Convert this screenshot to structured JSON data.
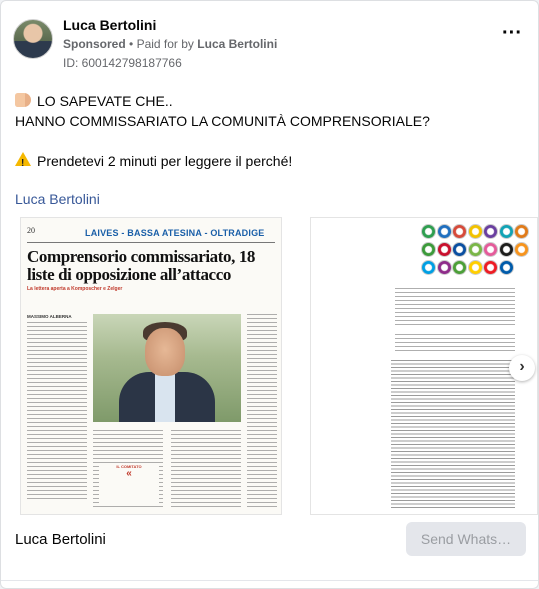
{
  "post": {
    "page_name": "Luca Bertolini",
    "sponsored_label": "Sponsored",
    "separator": "•",
    "paid_for_prefix": "Paid for by",
    "paid_for_name": "Luca Bertolini",
    "ad_id": "ID: 600142798187766",
    "more_icon": "more-horizontal-icon",
    "more_glyph": "···"
  },
  "body": {
    "line1": "LO SAPEVATE CHE..",
    "line1_icon": "pointing-hand-icon",
    "line2": "HANNO COMMISSARIATO LA COMUNITÀ COMPRENSORIALE?",
    "line3": "Prendetevi 2 minuti per leggere il perché!",
    "line3_icon": "warning-icon"
  },
  "link_name": "Luca Bertolini",
  "carousel": {
    "slide1": {
      "page_number": "20",
      "section": "LAIVES - BASSA ATESINA - OLTRADIGE",
      "headline": "Comprensorio commissariato, 18 liste di opposizione all’attacco",
      "subhead": "La lettera aperta a Komposcher e Zelger",
      "byline": "MASSIMO ALBERNA",
      "pull_label": "IL COMITATO"
    },
    "slide2": {
      "logo_colors": [
        "#2e9e4f",
        "#1f6fbf",
        "#d64a3a",
        "#f2c200",
        "#6a3fa0",
        "#11a3b5",
        "#e07b1a",
        "#3c9a3a",
        "#c8102e",
        "#0a4fa1",
        "#7ab648",
        "#e45b9a",
        "#1d1d1b",
        "#f7941d",
        "#009fe3",
        "#8e2c8a",
        "#4c9f38",
        "#ffce00",
        "#ed1c24",
        "#005baa"
      ]
    },
    "next_icon": "chevron-right-icon",
    "next_glyph": "›"
  },
  "footer": {
    "name": "Luca Bertolini",
    "cta_label": "Send Whats…"
  }
}
